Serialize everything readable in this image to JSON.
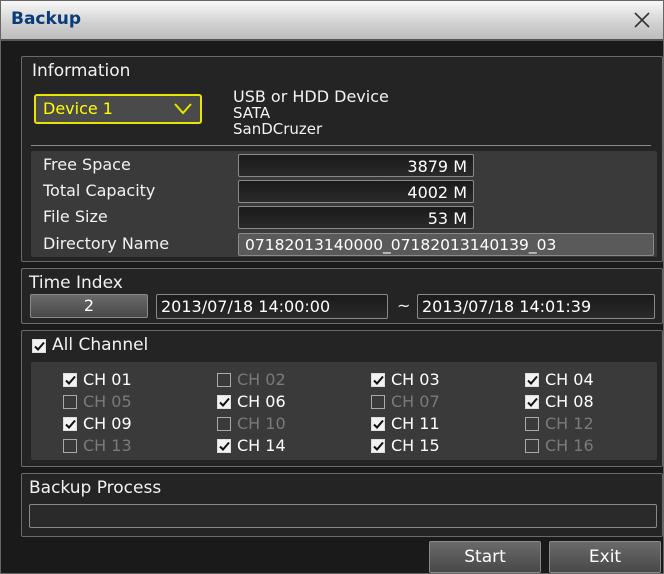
{
  "window": {
    "title": "Backup"
  },
  "information": {
    "label": "Information",
    "device": "Device 1",
    "device_info": [
      "USB or HDD Device",
      "SATA",
      "SanDCruzer"
    ],
    "rows": [
      {
        "label": "Free Space",
        "value": "3879 M"
      },
      {
        "label": "Total Capacity",
        "value": "4002 M"
      },
      {
        "label": "File Size",
        "value": "53 M"
      },
      {
        "label": "Directory Name",
        "value": "07182013140000_07182013140139_03"
      }
    ]
  },
  "time_index": {
    "label": "Time Index",
    "index": "2",
    "start": "2013/07/18  14:00:00",
    "separator": "~",
    "end": "2013/07/18  14:01:39"
  },
  "channels": {
    "all_label": "All Channel",
    "all_checked": true,
    "items": [
      {
        "label": "CH 01",
        "checked": true
      },
      {
        "label": "CH 02",
        "checked": false
      },
      {
        "label": "CH 03",
        "checked": true
      },
      {
        "label": "CH 04",
        "checked": true
      },
      {
        "label": "CH 05",
        "checked": false
      },
      {
        "label": "CH 06",
        "checked": true
      },
      {
        "label": "CH 07",
        "checked": false
      },
      {
        "label": "CH 08",
        "checked": true
      },
      {
        "label": "CH 09",
        "checked": true
      },
      {
        "label": "CH 10",
        "checked": false
      },
      {
        "label": "CH 11",
        "checked": true
      },
      {
        "label": "CH 12",
        "checked": false
      },
      {
        "label": "CH 13",
        "checked": false
      },
      {
        "label": "CH 14",
        "checked": true
      },
      {
        "label": "CH 15",
        "checked": true
      },
      {
        "label": "CH 16",
        "checked": false
      }
    ]
  },
  "backup_process": {
    "label": "Backup Process",
    "progress": 0
  },
  "buttons": {
    "start": "Start",
    "exit": "Exit"
  },
  "icons": {
    "close": "close-icon",
    "dropdown": "chevron-down-icon",
    "check": "checkmark-icon"
  },
  "colors": {
    "accent_yellow": "#ffff00",
    "title_text": "#0a3c7a"
  }
}
